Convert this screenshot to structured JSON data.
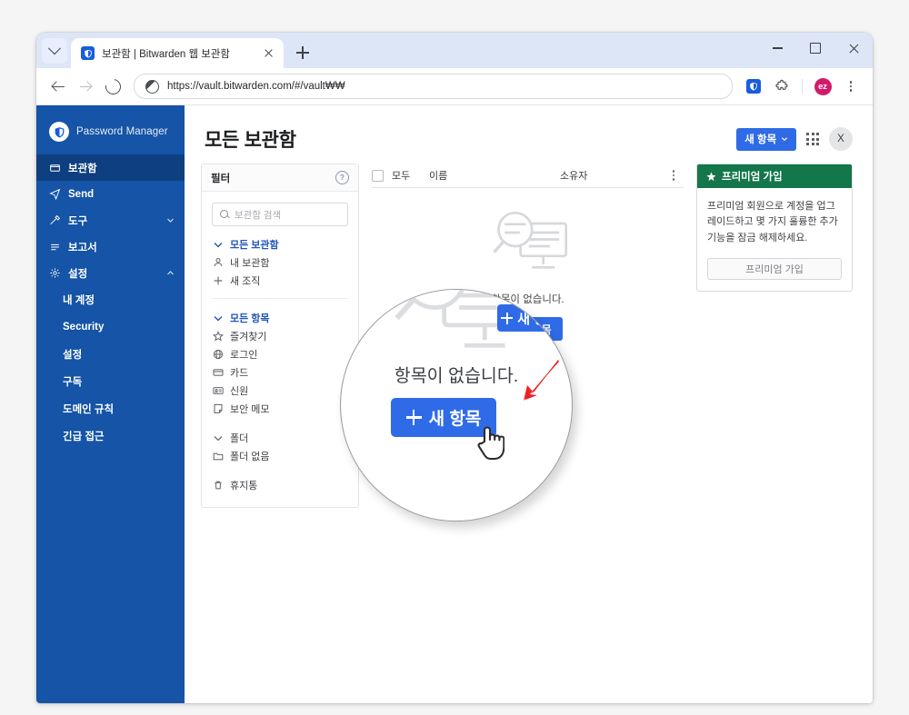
{
  "browser": {
    "tab": {
      "title": "보관함 | Bitwarden 웹 보관함",
      "favicon": "bitwarden-shield-icon",
      "close": "×"
    },
    "new_tab": "+",
    "window_controls": {
      "minimize": "minimize-icon",
      "maximize": "maximize-icon",
      "close": "close-icon"
    },
    "nav": {
      "back": "back-arrow-icon",
      "forward": "forward-arrow-icon",
      "reload": "reload-icon"
    },
    "omnibox": {
      "url": "https://vault.bitwarden.com/#/vault₩₩",
      "site_icon": "globe-icon"
    },
    "extensions": {
      "bitwarden": "bitwarden-extension-icon",
      "puzzle": "extensions-puzzle-icon"
    },
    "profile": {
      "initials": "ez"
    },
    "menu": "chrome-menu-icon"
  },
  "sidebar": {
    "brand": "Password Manager",
    "items": [
      {
        "label": "보관함",
        "icon": "vault-icon",
        "active": true,
        "caret": ""
      },
      {
        "label": "Send",
        "icon": "send-icon",
        "active": false,
        "caret": ""
      },
      {
        "label": "도구",
        "icon": "tools-icon",
        "active": false,
        "caret": "chevron-down-icon"
      },
      {
        "label": "보고서",
        "icon": "reports-icon",
        "active": false,
        "caret": ""
      },
      {
        "label": "설정",
        "icon": "gear-icon",
        "active": false,
        "caret": "chevron-up-icon"
      }
    ],
    "sub_items": [
      {
        "label": "내 계정"
      },
      {
        "label": "Security"
      },
      {
        "label": "설정"
      },
      {
        "label": "구독"
      },
      {
        "label": "도메인 규칙"
      },
      {
        "label": "긴급 접근"
      }
    ]
  },
  "header": {
    "title": "모든 보관함",
    "new_item_button": "새 항목",
    "new_item_caret": "chevron-down-icon",
    "apps_icon": "apps-grid-icon",
    "avatar": "X"
  },
  "filter_panel": {
    "title": "필터",
    "help_icon": "help-circle-icon",
    "search_placeholder": "보관함 검색",
    "search_value": "",
    "group_vaults": [
      {
        "label": "모든 보관함",
        "icon": "chevron-down-icon",
        "highlight": true
      },
      {
        "label": "내 보관함",
        "icon": "user-icon",
        "highlight": false
      },
      {
        "label": "새 조직",
        "icon": "plus-icon",
        "highlight": false
      }
    ],
    "group_items": [
      {
        "label": "모든 항목",
        "icon": "chevron-down-icon",
        "highlight": true
      },
      {
        "label": "즐겨찾기",
        "icon": "star-icon",
        "highlight": false
      },
      {
        "label": "로그인",
        "icon": "globe-icon",
        "highlight": false
      },
      {
        "label": "카드",
        "icon": "card-icon",
        "highlight": false
      },
      {
        "label": "신원",
        "icon": "id-card-icon",
        "highlight": false
      },
      {
        "label": "보안 메모",
        "icon": "note-icon",
        "highlight": false
      }
    ],
    "group_folders": [
      {
        "label": "폴더",
        "icon": "chevron-down-icon",
        "highlight": false
      },
      {
        "label": "폴더 없음",
        "icon": "folder-icon",
        "highlight": false
      }
    ],
    "group_trash": [
      {
        "label": "휴지통",
        "icon": "trash-icon",
        "highlight": false
      }
    ]
  },
  "list": {
    "columns": {
      "select_all": "모두",
      "name": "이름",
      "owner": "소유자"
    },
    "options_icon": "kebab-menu-icon",
    "empty_message": "항목이 없습니다.",
    "empty_button": "새 항목",
    "empty_art": "magnifier-over-monitor-icon"
  },
  "premium": {
    "header": "프리미엄 가입",
    "star_icon": "star-icon",
    "body": "프리미엄 회원으로 계정을 업그레이드하고 몇 가지 훌륭한 추가 기능을 잠금 해제하세요.",
    "button": "프리미엄 가입"
  },
  "magnifier": {
    "message": "항목이 없습니다.",
    "button": "새 항목",
    "arrow": "red-arrow-annotation",
    "cursor": "hand-pointer-cursor"
  },
  "colors": {
    "sidebar": "#1554A6",
    "sidebar_active": "#0E3F80",
    "primary_button": "#2F6BE6",
    "premium_green": "#14774B",
    "link_blue": "#2154B8",
    "profile_pink": "#d01b6a"
  }
}
